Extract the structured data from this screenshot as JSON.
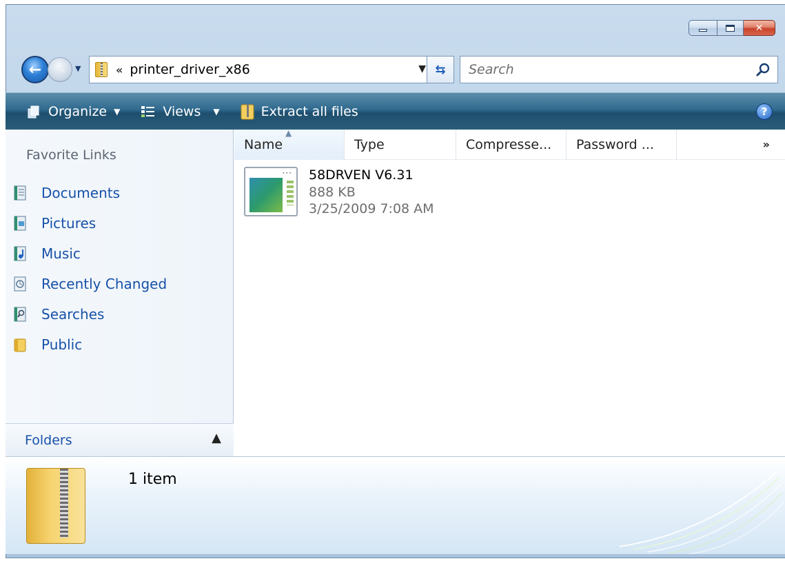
{
  "window": {
    "caption_buttons": {
      "minimize": "minimize",
      "maximize": "maximize",
      "close": "close"
    }
  },
  "nav": {
    "path_chevron": "«",
    "path": "printer_driver_x86",
    "search_placeholder": "Search"
  },
  "toolbar": {
    "organize_label": "Organize",
    "views_label": "Views",
    "extract_label": "Extract all files",
    "help_label": "?"
  },
  "sidebar": {
    "favorites_title": "Favorite Links",
    "items": [
      {
        "label": "Documents",
        "icon": "documents-icon"
      },
      {
        "label": "Pictures",
        "icon": "pictures-icon"
      },
      {
        "label": "Music",
        "icon": "music-icon"
      },
      {
        "label": "Recently Changed",
        "icon": "recently-changed-icon"
      },
      {
        "label": "Searches",
        "icon": "searches-icon"
      },
      {
        "label": "Public",
        "icon": "public-folder-icon"
      }
    ],
    "folders_label": "Folders"
  },
  "columns": {
    "name": "Name",
    "type": "Type",
    "compressed": "Compresse...",
    "password": "Password ...",
    "more": "»"
  },
  "file": {
    "name": "58DRVEN V6.31",
    "size": "888 KB",
    "date": "3/25/2009 7:08 AM"
  },
  "details": {
    "count": "1 item"
  },
  "colors": {
    "link_blue": "#1751a8",
    "command_bar": "#2f6a8e",
    "frame": "#b4cbe3",
    "close_red": "#c8432b"
  }
}
